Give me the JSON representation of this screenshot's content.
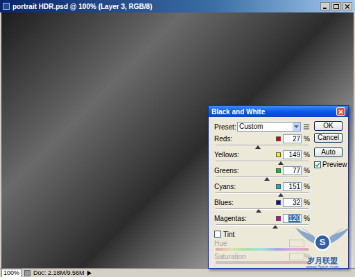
{
  "window": {
    "title": "portrait HDR.psd @ 100% (Layer 3, RGB/8)"
  },
  "status_bar": {
    "zoom": "100%",
    "doc": "Doc: 2.18M/9.56M"
  },
  "dialog": {
    "title": "Black and White",
    "preset": {
      "label": "Preset:",
      "value": "Custom"
    },
    "channels": [
      {
        "name": "Reds:",
        "value": "27",
        "unit": "%",
        "level": 0.454,
        "color": "#d40000",
        "selected": false
      },
      {
        "name": "Yellows:",
        "value": "149",
        "unit": "%",
        "level": 0.698,
        "color": "#f0f000",
        "selected": false
      },
      {
        "name": "Greens:",
        "value": "77",
        "unit": "%",
        "level": 0.554,
        "color": "#00cc22",
        "selected": false
      },
      {
        "name": "Cyans:",
        "value": "151",
        "unit": "%",
        "level": 0.702,
        "color": "#00b4e0",
        "selected": false
      },
      {
        "name": "Blues:",
        "value": "32",
        "unit": "%",
        "level": 0.464,
        "color": "#0010c0",
        "selected": false
      },
      {
        "name": "Magentas:",
        "value": "120",
        "unit": "%",
        "level": 0.64,
        "color": "#d000a0",
        "selected": true
      }
    ],
    "tint": {
      "label": "Tint",
      "checked": false
    },
    "hue": {
      "label": "Hue",
      "disabled": true
    },
    "saturation": {
      "label": "Saturation",
      "unit": "%",
      "disabled": true
    },
    "buttons": [
      {
        "label": "OK",
        "default": true
      },
      {
        "label": "Cancel",
        "default": false
      },
      {
        "label": "Auto",
        "default": false
      }
    ],
    "preview": {
      "label": "Preview",
      "checked": true
    }
  },
  "watermark": {
    "letter": "S",
    "name": "岁月联盟",
    "url": "www.9yue.com"
  }
}
